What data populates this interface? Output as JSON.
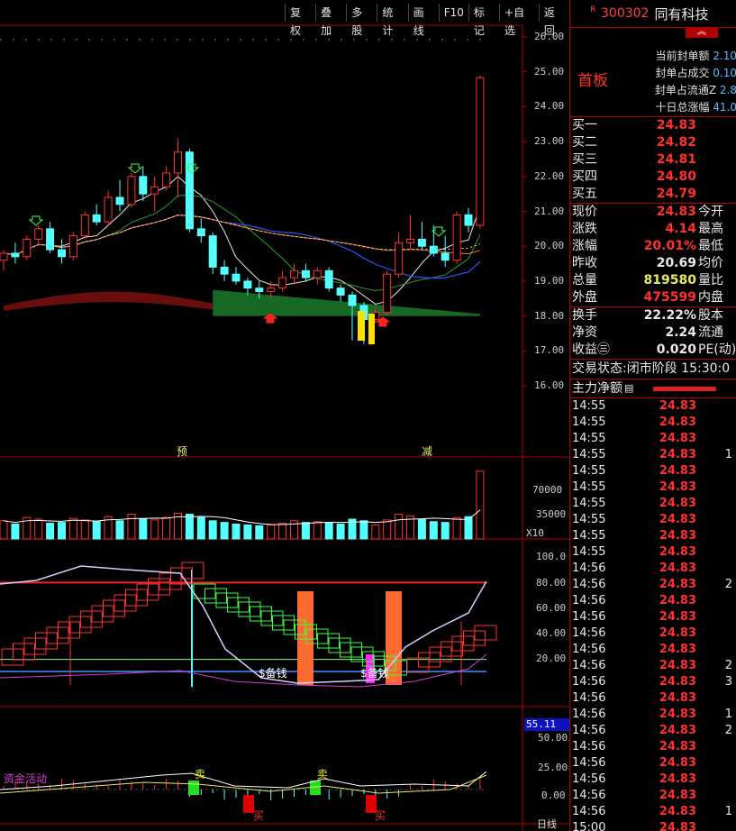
{
  "toolbar": [
    "复权",
    "叠加",
    "多股",
    "统计",
    "画线",
    "F10",
    "标记",
    "+自选",
    "返回"
  ],
  "price_axis": [
    "26.00",
    "25.00",
    "24.00",
    "23.00",
    "22.00",
    "21.00",
    "20.00",
    "19.00",
    "18.00",
    "17.00",
    "16.00"
  ],
  "vol_axis": [
    "70000",
    "35000",
    "X10"
  ],
  "ind1_axis": [
    "100.0",
    "80.00",
    "60.00",
    "40.00",
    "20.00"
  ],
  "ind2_axis": [
    "55.11",
    "50.00",
    "25.00",
    "0.00"
  ],
  "markers": {
    "yu": "预",
    "jian": "减",
    "bei1": "$备钱",
    "bei2": "$备钱",
    "sell1": "卖",
    "sell2": "卖",
    "buy1": "买",
    "buy2": "买",
    "fund": "资金活动",
    "bottom_right": "日线"
  },
  "chart_data": {
    "type": "candlestick",
    "price_range": [
      16,
      26
    ],
    "candles": [
      [
        19.6,
        19.9,
        19.3,
        19.8
      ],
      [
        19.8,
        20.1,
        19.5,
        19.7
      ],
      [
        19.7,
        20.3,
        19.6,
        20.2
      ],
      [
        20.2,
        20.6,
        20.0,
        20.5
      ],
      [
        20.5,
        20.7,
        19.8,
        19.9
      ],
      [
        19.9,
        20.2,
        19.5,
        19.7
      ],
      [
        19.7,
        20.4,
        19.6,
        20.3
      ],
      [
        20.3,
        21.0,
        20.2,
        20.9
      ],
      [
        20.9,
        21.2,
        20.6,
        20.7
      ],
      [
        20.7,
        21.6,
        20.6,
        21.4
      ],
      [
        21.4,
        21.9,
        21.0,
        21.2
      ],
      [
        21.2,
        22.1,
        21.1,
        22.0
      ],
      [
        22.0,
        22.3,
        21.3,
        21.5
      ],
      [
        21.5,
        22.0,
        21.0,
        21.7
      ],
      [
        21.7,
        22.3,
        21.6,
        22.1
      ],
      [
        22.1,
        23.1,
        21.4,
        22.7
      ],
      [
        22.7,
        22.8,
        20.4,
        20.5
      ],
      [
        20.5,
        20.8,
        20.1,
        20.3
      ],
      [
        20.3,
        20.4,
        19.2,
        19.4
      ],
      [
        19.4,
        19.6,
        19.0,
        19.2
      ],
      [
        19.2,
        19.4,
        18.9,
        19.0
      ],
      [
        19.0,
        19.1,
        18.6,
        18.8
      ],
      [
        18.8,
        19.0,
        18.5,
        18.7
      ],
      [
        18.7,
        19.0,
        18.5,
        18.8
      ],
      [
        18.8,
        19.3,
        18.7,
        19.1
      ],
      [
        19.1,
        19.5,
        18.9,
        19.3
      ],
      [
        19.3,
        19.5,
        19.0,
        19.1
      ],
      [
        19.1,
        19.4,
        18.9,
        19.3
      ],
      [
        19.3,
        19.4,
        18.7,
        18.8
      ],
      [
        18.8,
        18.9,
        18.4,
        18.6
      ],
      [
        18.6,
        18.7,
        17.3,
        18.3
      ],
      [
        18.3,
        18.4,
        17.2,
        17.9
      ],
      [
        17.9,
        18.2,
        17.8,
        18.1
      ],
      [
        18.1,
        19.3,
        18.0,
        19.2
      ],
      [
        19.2,
        20.4,
        19.1,
        20.1
      ],
      [
        20.1,
        20.9,
        19.9,
        20.2
      ],
      [
        20.2,
        20.7,
        19.9,
        20.0
      ],
      [
        20.0,
        20.6,
        19.7,
        19.8
      ],
      [
        19.8,
        20.3,
        19.4,
        19.6
      ],
      [
        19.6,
        21.0,
        19.5,
        20.9
      ],
      [
        20.9,
        21.1,
        20.4,
        20.6
      ],
      [
        20.6,
        24.9,
        20.5,
        24.83
      ]
    ],
    "volumes": [
      22000,
      18000,
      26000,
      24000,
      19000,
      20000,
      25000,
      23000,
      21000,
      27000,
      22000,
      30000,
      24000,
      23000,
      26000,
      31000,
      30000,
      26000,
      22000,
      20000,
      18000,
      17000,
      16000,
      17000,
      19000,
      22000,
      20000,
      21000,
      19000,
      18000,
      24000,
      22000,
      17000,
      23000,
      30000,
      28000,
      24000,
      21000,
      20000,
      26000,
      27000,
      82000
    ],
    "ind1_range": [
      0,
      100
    ],
    "ind2_range": [
      -25,
      55.11
    ]
  },
  "quote": {
    "code": "300302",
    "name": "同有科技",
    "r": "R",
    "tag": "首板",
    "seal": [
      [
        "当前封单额",
        "2.10"
      ],
      [
        "封单占成交",
        "0.10"
      ],
      [
        "封单占流通Z",
        "2.8"
      ],
      [
        "十日总涨幅",
        "41.0"
      ]
    ],
    "orderbook": [
      [
        "买一",
        "24.83"
      ],
      [
        "买二",
        "24.82"
      ],
      [
        "买三",
        "24.81"
      ],
      [
        "买四",
        "24.80"
      ],
      [
        "买五",
        "24.79"
      ]
    ],
    "stats": [
      [
        "现价",
        "24.83",
        "今开",
        "#ff3030"
      ],
      [
        "涨跌",
        "4.14",
        "最高",
        "#ff3030"
      ],
      [
        "涨幅",
        "20.01%",
        "最低",
        "#ff3030"
      ],
      [
        "昨收",
        "20.69",
        "均价",
        "#e8e8e8"
      ],
      [
        "总量",
        "819580",
        "量比",
        "#e8e860"
      ],
      [
        "外盘",
        "475599",
        "内盘",
        "#ff3030"
      ]
    ],
    "stats2": [
      [
        "换手",
        "22.22%",
        "股本",
        "#e8e8e8"
      ],
      [
        "净资",
        "2.24",
        "流通",
        "#e8e8e8"
      ],
      [
        "收益㊂",
        "0.020",
        "PE(动)",
        "#e8e8e8"
      ]
    ],
    "status": "交易状态:闭市阶段 15:30:0",
    "net": "主力净额",
    "ticks": [
      [
        "14:55",
        "24.83",
        ""
      ],
      [
        "14:55",
        "24.83",
        ""
      ],
      [
        "14:55",
        "24.83",
        ""
      ],
      [
        "14:55",
        "24.83",
        "1"
      ],
      [
        "14:55",
        "24.83",
        ""
      ],
      [
        "14:55",
        "24.83",
        ""
      ],
      [
        "14:55",
        "24.83",
        ""
      ],
      [
        "14:55",
        "24.83",
        ""
      ],
      [
        "14:55",
        "24.83",
        ""
      ],
      [
        "14:55",
        "24.83",
        ""
      ],
      [
        "14:56",
        "24.83",
        ""
      ],
      [
        "14:56",
        "24.83",
        "2"
      ],
      [
        "14:56",
        "24.83",
        ""
      ],
      [
        "14:56",
        "24.83",
        ""
      ],
      [
        "14:56",
        "24.83",
        ""
      ],
      [
        "14:56",
        "24.83",
        ""
      ],
      [
        "14:56",
        "24.83",
        "2"
      ],
      [
        "14:56",
        "24.83",
        "3"
      ],
      [
        "14:56",
        "24.83",
        ""
      ],
      [
        "14:56",
        "24.83",
        "1"
      ],
      [
        "14:56",
        "24.83",
        "2"
      ],
      [
        "14:56",
        "24.83",
        ""
      ],
      [
        "14:56",
        "24.83",
        ""
      ],
      [
        "14:56",
        "24.83",
        ""
      ],
      [
        "14:56",
        "24.83",
        ""
      ],
      [
        "14:56",
        "24.83",
        "1"
      ],
      [
        "15:00",
        "24.83",
        ""
      ]
    ]
  }
}
